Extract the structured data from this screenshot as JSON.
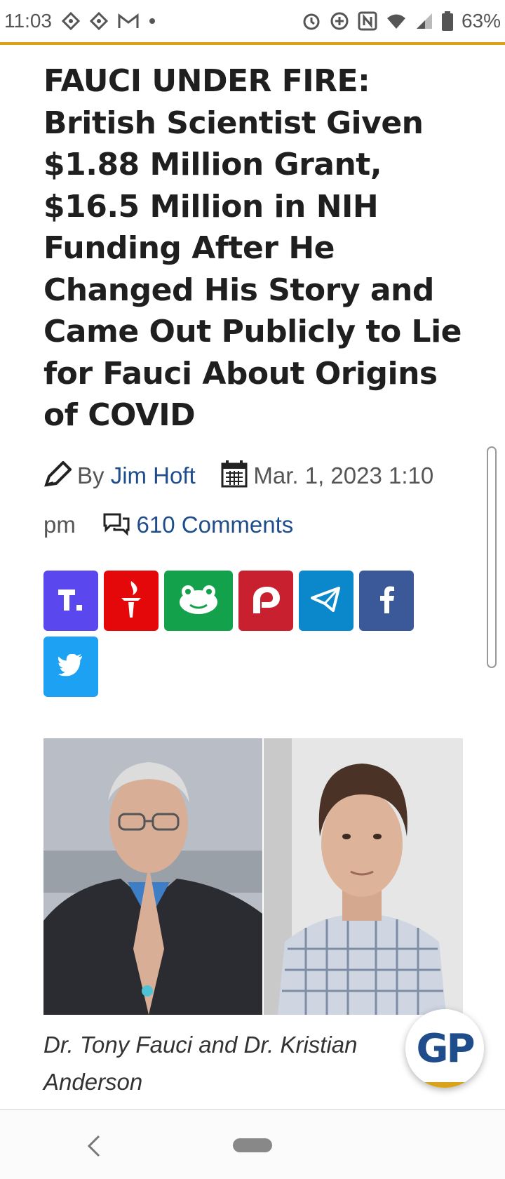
{
  "status_bar": {
    "time": "11:03",
    "battery": "63%",
    "left_icons": [
      "app-diamond-icon",
      "app-diamond-icon",
      "gmail-icon",
      "dot-icon"
    ],
    "right_icons": [
      "alarm-icon",
      "data-saver-icon",
      "nfc-icon",
      "wifi-icon",
      "signal-icon",
      "battery-icon"
    ]
  },
  "article": {
    "title": "FAUCI UNDER FIRE: British Scientist Given $1.88 Million Grant, $16.5 Million in NIH Funding After He Changed His Story and Came Out Publicly to Lie for Fauci About Origins of COVID",
    "by_label": "By",
    "author": "Jim Hoft",
    "date": "Mar. 1, 2023 1:10 pm",
    "comments": "610 Comments",
    "caption": "Dr. Tony Fauci and Dr. Kristian Anderson"
  },
  "share_buttons": [
    {
      "name": "truth-social",
      "icon": "truth-social-icon",
      "color": "#5b47ee"
    },
    {
      "name": "gettr",
      "icon": "gettr-torch-icon",
      "color": "#e4080a"
    },
    {
      "name": "gab",
      "icon": "gab-frog-icon",
      "color": "#13a14b"
    },
    {
      "name": "parler",
      "icon": "parler-icon",
      "color": "#c8202f"
    },
    {
      "name": "telegram",
      "icon": "telegram-icon",
      "color": "#0b88cc"
    },
    {
      "name": "facebook",
      "icon": "facebook-icon",
      "color": "#3b5998"
    },
    {
      "name": "twitter",
      "icon": "twitter-icon",
      "color": "#1da1f2"
    }
  ],
  "badge": {
    "text": "GP"
  },
  "colors": {
    "accent": "#d9a217",
    "link": "#1f4d8c"
  }
}
